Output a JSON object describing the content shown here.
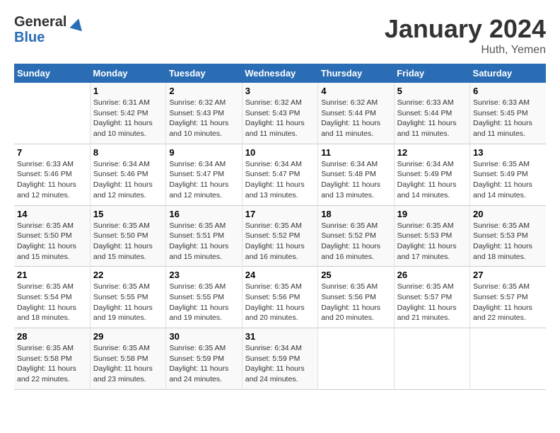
{
  "header": {
    "logo_line1": "General",
    "logo_line2": "Blue",
    "month": "January 2024",
    "location": "Huth, Yemen"
  },
  "days_of_week": [
    "Sunday",
    "Monday",
    "Tuesday",
    "Wednesday",
    "Thursday",
    "Friday",
    "Saturday"
  ],
  "weeks": [
    [
      {
        "num": "",
        "sunrise": "",
        "sunset": "",
        "daylight": ""
      },
      {
        "num": "1",
        "sunrise": "Sunrise: 6:31 AM",
        "sunset": "Sunset: 5:42 PM",
        "daylight": "Daylight: 11 hours and 10 minutes."
      },
      {
        "num": "2",
        "sunrise": "Sunrise: 6:32 AM",
        "sunset": "Sunset: 5:43 PM",
        "daylight": "Daylight: 11 hours and 10 minutes."
      },
      {
        "num": "3",
        "sunrise": "Sunrise: 6:32 AM",
        "sunset": "Sunset: 5:43 PM",
        "daylight": "Daylight: 11 hours and 11 minutes."
      },
      {
        "num": "4",
        "sunrise": "Sunrise: 6:32 AM",
        "sunset": "Sunset: 5:44 PM",
        "daylight": "Daylight: 11 hours and 11 minutes."
      },
      {
        "num": "5",
        "sunrise": "Sunrise: 6:33 AM",
        "sunset": "Sunset: 5:44 PM",
        "daylight": "Daylight: 11 hours and 11 minutes."
      },
      {
        "num": "6",
        "sunrise": "Sunrise: 6:33 AM",
        "sunset": "Sunset: 5:45 PM",
        "daylight": "Daylight: 11 hours and 11 minutes."
      }
    ],
    [
      {
        "num": "7",
        "sunrise": "Sunrise: 6:33 AM",
        "sunset": "Sunset: 5:46 PM",
        "daylight": "Daylight: 11 hours and 12 minutes."
      },
      {
        "num": "8",
        "sunrise": "Sunrise: 6:34 AM",
        "sunset": "Sunset: 5:46 PM",
        "daylight": "Daylight: 11 hours and 12 minutes."
      },
      {
        "num": "9",
        "sunrise": "Sunrise: 6:34 AM",
        "sunset": "Sunset: 5:47 PM",
        "daylight": "Daylight: 11 hours and 12 minutes."
      },
      {
        "num": "10",
        "sunrise": "Sunrise: 6:34 AM",
        "sunset": "Sunset: 5:47 PM",
        "daylight": "Daylight: 11 hours and 13 minutes."
      },
      {
        "num": "11",
        "sunrise": "Sunrise: 6:34 AM",
        "sunset": "Sunset: 5:48 PM",
        "daylight": "Daylight: 11 hours and 13 minutes."
      },
      {
        "num": "12",
        "sunrise": "Sunrise: 6:34 AM",
        "sunset": "Sunset: 5:49 PM",
        "daylight": "Daylight: 11 hours and 14 minutes."
      },
      {
        "num": "13",
        "sunrise": "Sunrise: 6:35 AM",
        "sunset": "Sunset: 5:49 PM",
        "daylight": "Daylight: 11 hours and 14 minutes."
      }
    ],
    [
      {
        "num": "14",
        "sunrise": "Sunrise: 6:35 AM",
        "sunset": "Sunset: 5:50 PM",
        "daylight": "Daylight: 11 hours and 15 minutes."
      },
      {
        "num": "15",
        "sunrise": "Sunrise: 6:35 AM",
        "sunset": "Sunset: 5:50 PM",
        "daylight": "Daylight: 11 hours and 15 minutes."
      },
      {
        "num": "16",
        "sunrise": "Sunrise: 6:35 AM",
        "sunset": "Sunset: 5:51 PM",
        "daylight": "Daylight: 11 hours and 15 minutes."
      },
      {
        "num": "17",
        "sunrise": "Sunrise: 6:35 AM",
        "sunset": "Sunset: 5:52 PM",
        "daylight": "Daylight: 11 hours and 16 minutes."
      },
      {
        "num": "18",
        "sunrise": "Sunrise: 6:35 AM",
        "sunset": "Sunset: 5:52 PM",
        "daylight": "Daylight: 11 hours and 16 minutes."
      },
      {
        "num": "19",
        "sunrise": "Sunrise: 6:35 AM",
        "sunset": "Sunset: 5:53 PM",
        "daylight": "Daylight: 11 hours and 17 minutes."
      },
      {
        "num": "20",
        "sunrise": "Sunrise: 6:35 AM",
        "sunset": "Sunset: 5:53 PM",
        "daylight": "Daylight: 11 hours and 18 minutes."
      }
    ],
    [
      {
        "num": "21",
        "sunrise": "Sunrise: 6:35 AM",
        "sunset": "Sunset: 5:54 PM",
        "daylight": "Daylight: 11 hours and 18 minutes."
      },
      {
        "num": "22",
        "sunrise": "Sunrise: 6:35 AM",
        "sunset": "Sunset: 5:55 PM",
        "daylight": "Daylight: 11 hours and 19 minutes."
      },
      {
        "num": "23",
        "sunrise": "Sunrise: 6:35 AM",
        "sunset": "Sunset: 5:55 PM",
        "daylight": "Daylight: 11 hours and 19 minutes."
      },
      {
        "num": "24",
        "sunrise": "Sunrise: 6:35 AM",
        "sunset": "Sunset: 5:56 PM",
        "daylight": "Daylight: 11 hours and 20 minutes."
      },
      {
        "num": "25",
        "sunrise": "Sunrise: 6:35 AM",
        "sunset": "Sunset: 5:56 PM",
        "daylight": "Daylight: 11 hours and 20 minutes."
      },
      {
        "num": "26",
        "sunrise": "Sunrise: 6:35 AM",
        "sunset": "Sunset: 5:57 PM",
        "daylight": "Daylight: 11 hours and 21 minutes."
      },
      {
        "num": "27",
        "sunrise": "Sunrise: 6:35 AM",
        "sunset": "Sunset: 5:57 PM",
        "daylight": "Daylight: 11 hours and 22 minutes."
      }
    ],
    [
      {
        "num": "28",
        "sunrise": "Sunrise: 6:35 AM",
        "sunset": "Sunset: 5:58 PM",
        "daylight": "Daylight: 11 hours and 22 minutes."
      },
      {
        "num": "29",
        "sunrise": "Sunrise: 6:35 AM",
        "sunset": "Sunset: 5:58 PM",
        "daylight": "Daylight: 11 hours and 23 minutes."
      },
      {
        "num": "30",
        "sunrise": "Sunrise: 6:35 AM",
        "sunset": "Sunset: 5:59 PM",
        "daylight": "Daylight: 11 hours and 24 minutes."
      },
      {
        "num": "31",
        "sunrise": "Sunrise: 6:34 AM",
        "sunset": "Sunset: 5:59 PM",
        "daylight": "Daylight: 11 hours and 24 minutes."
      },
      {
        "num": "",
        "sunrise": "",
        "sunset": "",
        "daylight": ""
      },
      {
        "num": "",
        "sunrise": "",
        "sunset": "",
        "daylight": ""
      },
      {
        "num": "",
        "sunrise": "",
        "sunset": "",
        "daylight": ""
      }
    ]
  ]
}
